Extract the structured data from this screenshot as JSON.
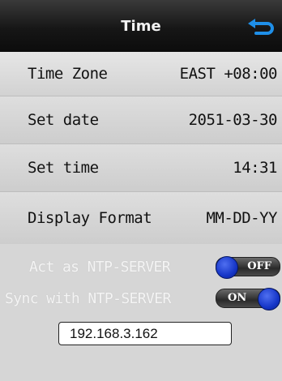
{
  "header": {
    "title": "Time",
    "back_icon": "back-arrow-icon"
  },
  "settings": [
    {
      "label": "Time Zone",
      "value": "EAST +08:00"
    },
    {
      "label": "Set date",
      "value": "2051-03-30"
    },
    {
      "label": "Set time",
      "value": "14:31"
    },
    {
      "label": "Display Format",
      "value": "MM-DD-YY"
    }
  ],
  "ntp": {
    "act_as_server": {
      "label": "Act as NTP-SERVER",
      "state": "OFF"
    },
    "sync_with_server": {
      "label": "Sync with NTP-SERVER",
      "state": "ON"
    },
    "server_ip": "192.168.3.162"
  },
  "colors": {
    "header": "#161616",
    "toggle_knob": "#1636c8",
    "background": "#d8d8d8"
  }
}
